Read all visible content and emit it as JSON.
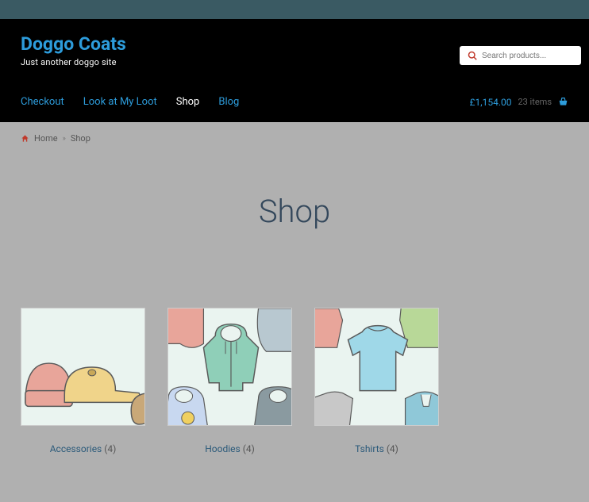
{
  "site": {
    "title": "Doggo Coats",
    "tagline": "Just another doggo site"
  },
  "search": {
    "placeholder": "Search products..."
  },
  "nav": {
    "items": [
      {
        "label": "Checkout",
        "active": false
      },
      {
        "label": "Look at My Loot",
        "active": false
      },
      {
        "label": "Shop",
        "active": true
      },
      {
        "label": "Blog",
        "active": false
      }
    ]
  },
  "cart": {
    "total": "£1,154.00",
    "items_label": "23 items"
  },
  "breadcrumb": {
    "home_label": "Home",
    "separator": "»",
    "current": "Shop"
  },
  "page": {
    "title": "Shop"
  },
  "categories": [
    {
      "name": "Accessories",
      "count": "(4)"
    },
    {
      "name": "Hoodies",
      "count": "(4)"
    },
    {
      "name": "Tshirts",
      "count": "(4)"
    }
  ],
  "colors": {
    "accent": "#2d9cdb",
    "home_icon": "#c0392b",
    "search_icon": "#c0392b"
  }
}
